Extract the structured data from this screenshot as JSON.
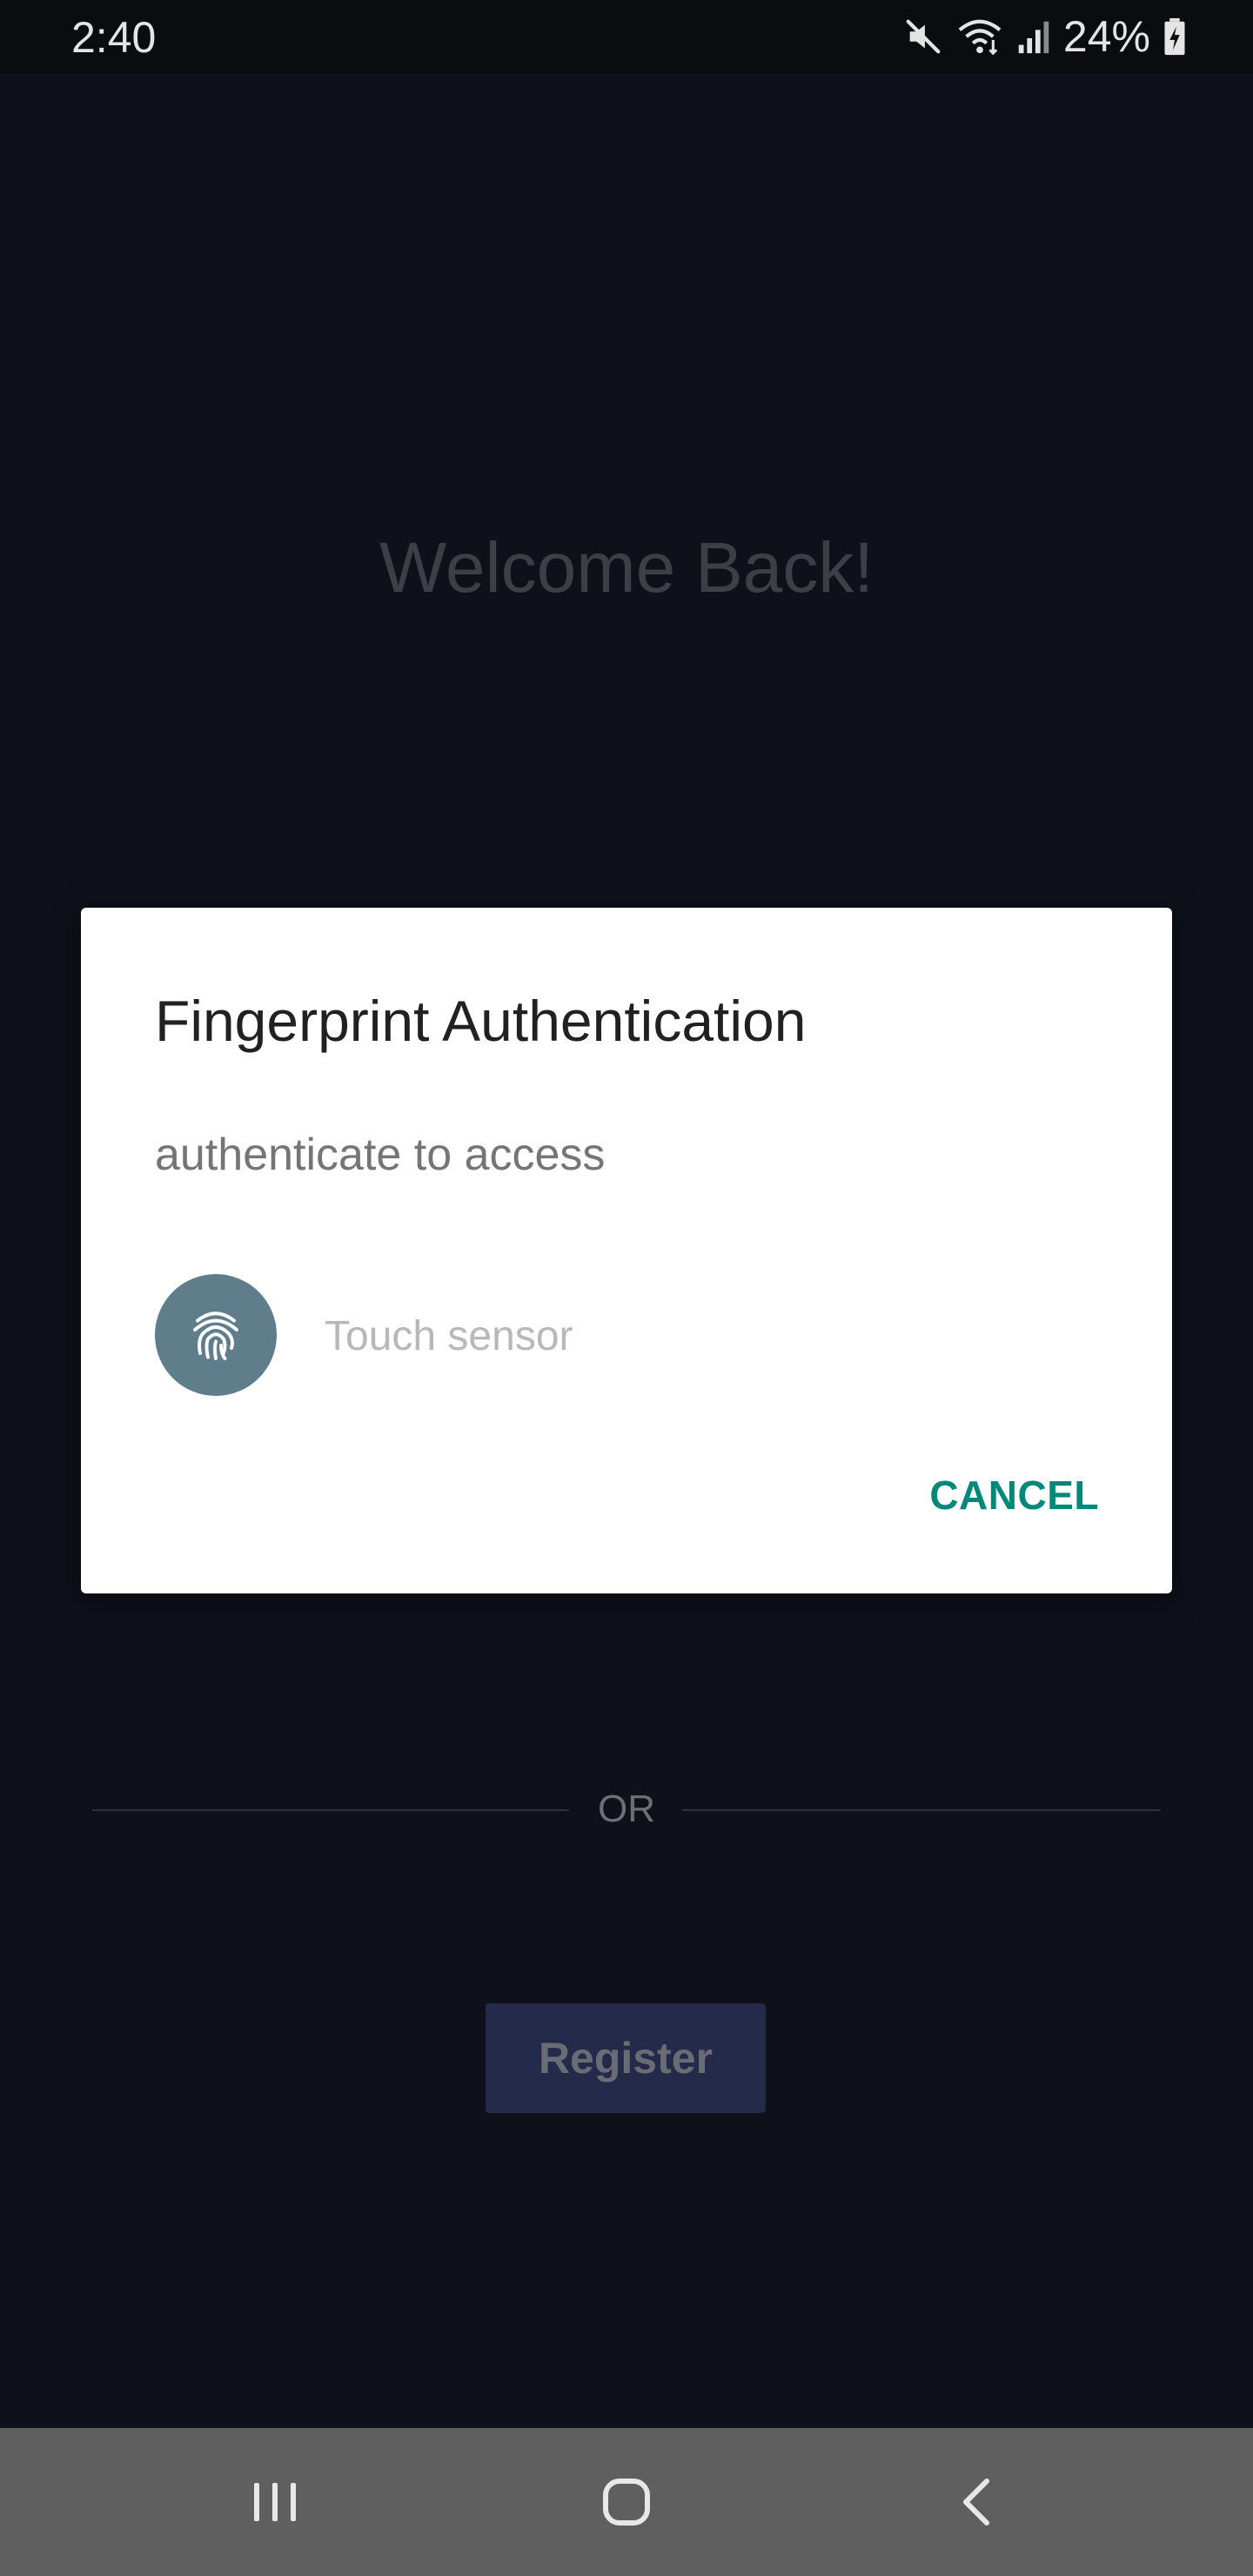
{
  "status_bar": {
    "time": "2:40",
    "battery_percent": "24%",
    "icons": [
      "mute-icon",
      "wifi-icon",
      "signal-icon",
      "battery-charging-icon"
    ]
  },
  "background": {
    "welcome_title": "Welcome Back!",
    "or_label": "OR",
    "register_label": "Register"
  },
  "dialog": {
    "title": "Fingerprint Authentication",
    "description": "authenticate to access",
    "sensor_hint": "Touch sensor",
    "cancel_label": "CANCEL",
    "fingerprint_icon": "fingerprint-icon"
  },
  "nav_bar": {
    "icons": [
      "recent-apps-icon",
      "home-icon",
      "back-icon"
    ]
  },
  "colors": {
    "background": "#0e111a",
    "dialog": "#ffffff",
    "accent": "#00897b",
    "fingerprint_circle": "#607d8b",
    "register_button": "#232a4a",
    "nav_bar": "#5f5f5f"
  }
}
